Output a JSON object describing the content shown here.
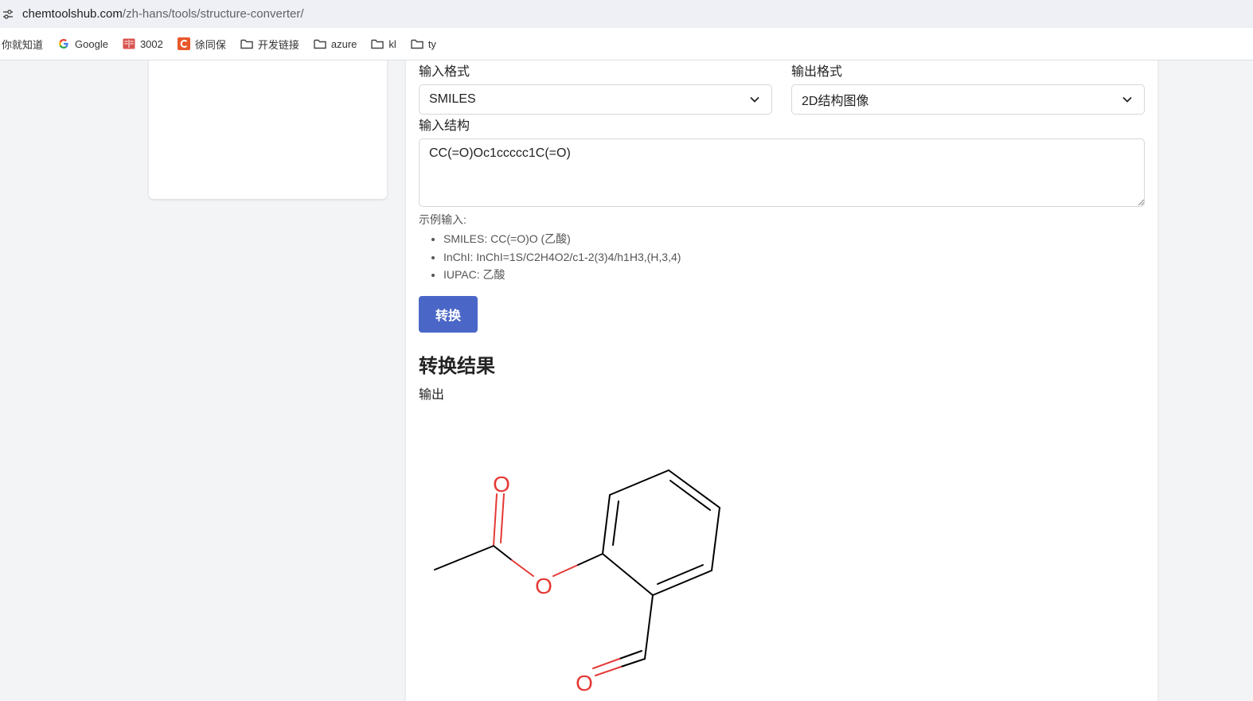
{
  "browser": {
    "url_host": "chemtoolshub.com",
    "url_path": "/zh-hans/tools/structure-converter/",
    "bookmarks": [
      {
        "label": "你就知道",
        "icon": "none"
      },
      {
        "label": "Google",
        "icon": "google-icon"
      },
      {
        "label": "3002",
        "icon": "book-icon"
      },
      {
        "label": "徐同保",
        "icon": "c-logo-icon"
      },
      {
        "label": "开发链接",
        "icon": "folder-icon"
      },
      {
        "label": "azure",
        "icon": "folder-icon"
      },
      {
        "label": "kl",
        "icon": "folder-icon"
      },
      {
        "label": "ty",
        "icon": "folder-icon"
      }
    ]
  },
  "form": {
    "input_format_label": "输入格式",
    "input_format_value": "SMILES",
    "output_format_label": "输出格式",
    "output_format_value": "2D结构图像",
    "input_structure_label": "输入结构",
    "input_structure_value": "CC(=O)Oc1ccccc1C(=O)",
    "hint_title": "示例输入:",
    "examples": [
      "SMILES: CC(=O)O (乙酸)",
      "InChI: InChI=1S/C2H4O2/c1-2(3)4/h1H3,(H,3,4)",
      "IUPAC: 乙酸"
    ],
    "convert_label": "转换"
  },
  "result": {
    "title": "转换结果",
    "output_label": "输出",
    "atom_labels": [
      "O",
      "O",
      "O"
    ]
  },
  "colors": {
    "accent": "#4a67c8",
    "oxygen": "#e53935",
    "bond": "#000000"
  }
}
